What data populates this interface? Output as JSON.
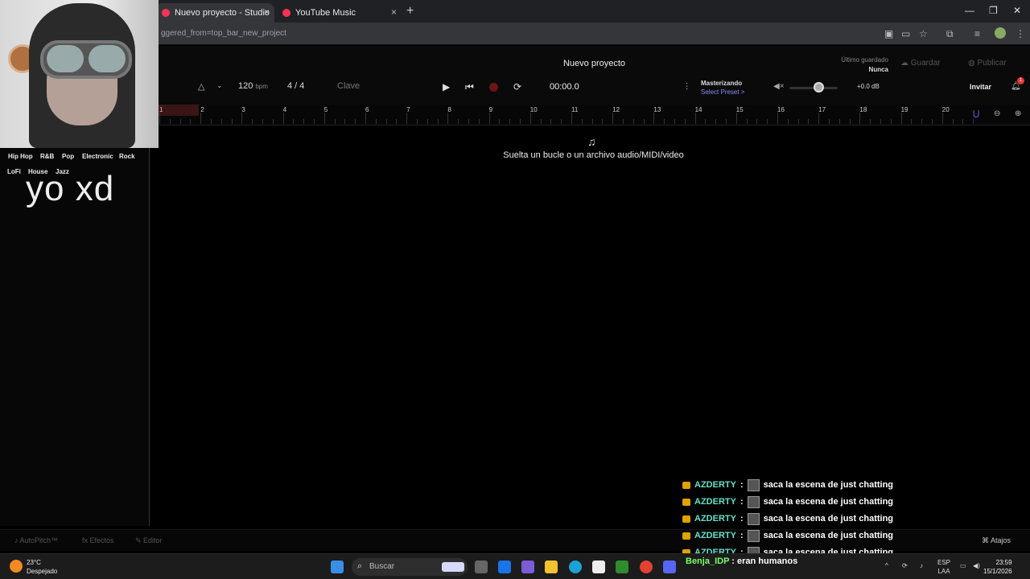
{
  "browser": {
    "tabs": [
      {
        "label": "Nuevo proyecto - Studio",
        "active": true
      },
      {
        "label": "YouTube Music",
        "active": false
      }
    ],
    "url": "ggered_from=top_bar_new_project",
    "new_tab": "+",
    "close_glyph": "×",
    "window_controls": [
      "—",
      "❐",
      "✕"
    ]
  },
  "app": {
    "project_title": "Nuevo proyecto",
    "last_saved_label": "Último guardado",
    "last_saved_value": "Nunca",
    "save_label": "Guardar",
    "publish_label": "Publicar",
    "bpm": "120",
    "bpm_unit": "bpm",
    "time_signature": "4 / 4",
    "key_label": "Clave",
    "timecode": "00:00.0",
    "mastering_label": "Masterizando",
    "preset_label": "Select Preset >",
    "volume_db": "+0.0 dB",
    "volume_level": 0.6,
    "invite_label": "Invitar",
    "notification_count": "1",
    "ruler": [
      "1",
      "2",
      "3",
      "4",
      "5",
      "6",
      "7",
      "8",
      "9",
      "10",
      "11",
      "12",
      "13",
      "14",
      "15",
      "16",
      "17",
      "18",
      "19",
      "20"
    ],
    "drop_hint": "Suelta un bucle o un archivo audio/MIDI/video",
    "genres_row1": [
      "Hip Hop",
      "R&B",
      "Pop",
      "Electronic",
      "Rock"
    ],
    "genres_row2": [
      "LoFi",
      "House",
      "Jazz"
    ],
    "bottom": {
      "autopitch": "AutoPitch™",
      "effects": "Efectos",
      "editor": "Editor",
      "shortcuts": "Atajos"
    }
  },
  "overlay_text": "yo xd",
  "chat": [
    {
      "user": "AZDERTY",
      "message": "saca la escena de just chatting"
    },
    {
      "user": "AZDERTY",
      "message": "saca la escena de just chatting"
    },
    {
      "user": "AZDERTY",
      "message": "saca la escena de just chatting"
    },
    {
      "user": "AZDERTY",
      "message": "saca la escena de just chatting"
    },
    {
      "user": "AZDERTY",
      "message": "saca la escena de just chatting"
    }
  ],
  "chat_last": {
    "user": "Benja_IDP",
    "message": ": eran humanos"
  },
  "taskbar": {
    "temperature": "23°C",
    "weather": "Despejado",
    "search_placeholder": "Buscar",
    "lang1": "ESP",
    "lang2": "LAA",
    "time": "23:59",
    "date": "15/1/2026"
  },
  "colors": {
    "accent_purple": "#8c8cff",
    "record": "#6b1515",
    "chat_user": "#66e0c8",
    "chat_last_user": "#7cff6b"
  }
}
